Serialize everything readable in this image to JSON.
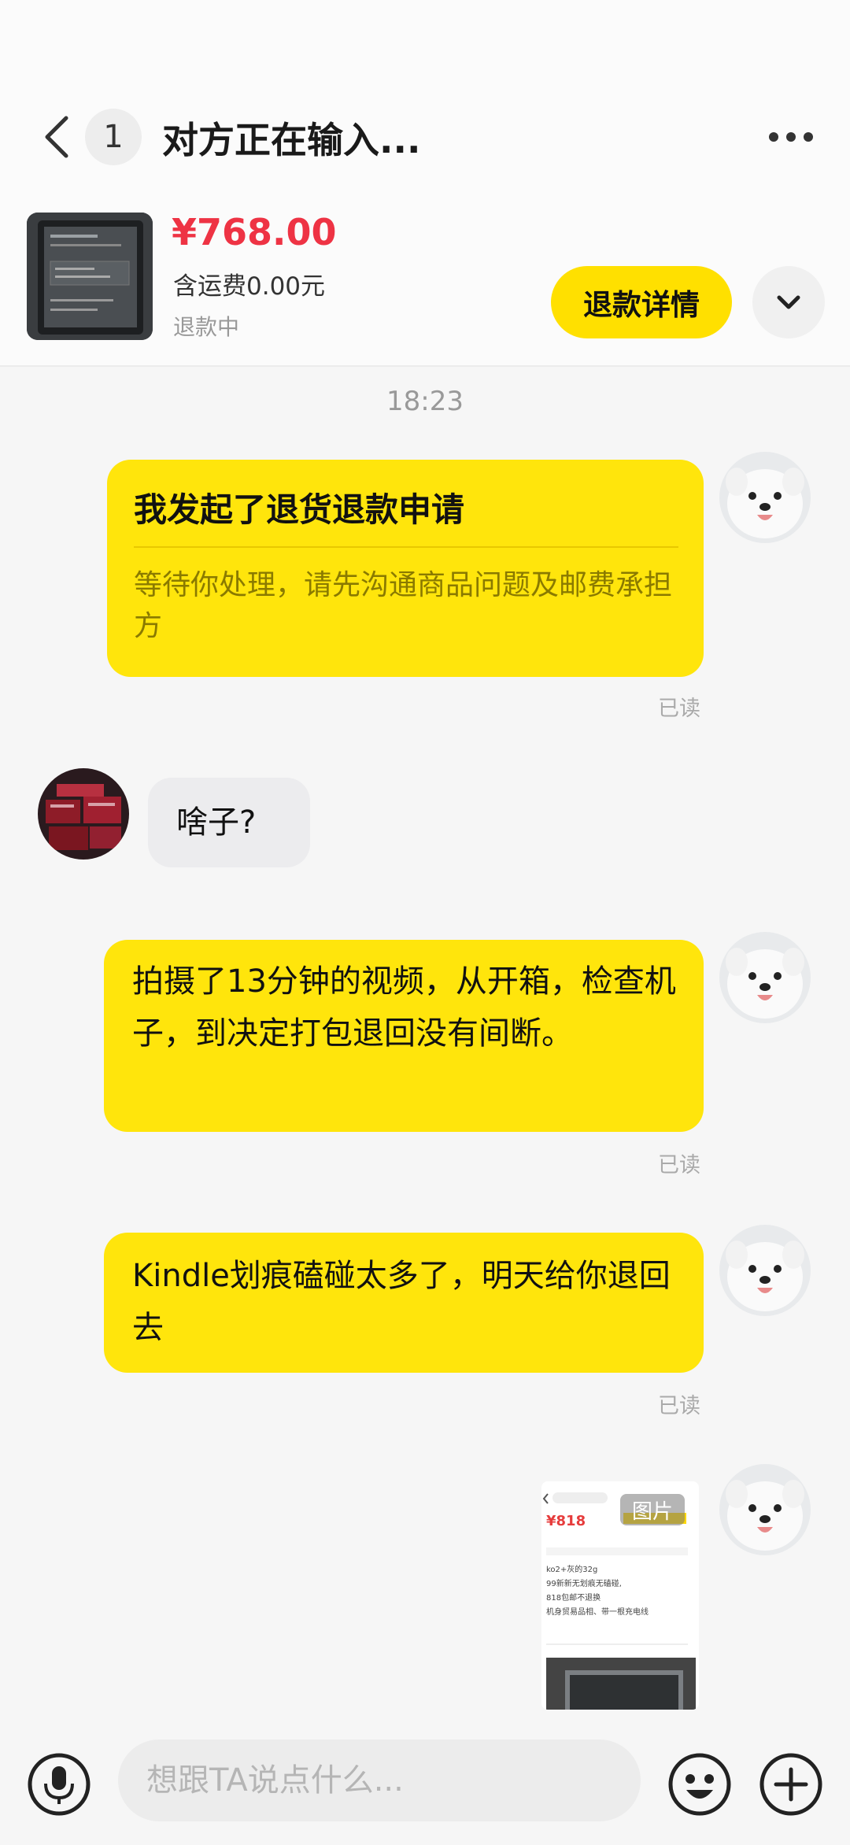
{
  "header": {
    "back_icon": "chevron-left-icon",
    "unread_count": "1",
    "title": "对方正在输入...",
    "more_icon": "more-horizontal-icon"
  },
  "product": {
    "price": "¥768.00",
    "shipping": "含运费0.00元",
    "status": "退款中",
    "refund_button": "退款详情",
    "expand_icon": "chevron-down-icon"
  },
  "chat": {
    "timestamp": "18:23",
    "refund_card": {
      "title": "我发起了退货退款申请",
      "subtitle": "等待你处理，请先沟通商品问题及邮费承担方",
      "read": "已读"
    },
    "other_message": {
      "text": "啥子?"
    },
    "message_2": {
      "text": "拍摄了13分钟的视频，从开箱，检查机子，到决定打包退回没有间断。",
      "read": "已读"
    },
    "message_3": {
      "text": "Kindle划痕磕碰太多了，明天给你退回去",
      "read": "已读"
    },
    "image_message": {
      "tag": "图片",
      "preview_price": "¥818",
      "preview_lines": [
        "ko2+灰的32g",
        "99新新无划痕无磕碰,",
        "818包邮不退换",
        "机身贸易品相、带一根充电线"
      ]
    }
  },
  "input_bar": {
    "mic_icon": "microphone-icon",
    "placeholder": "想跟TA说点什么...",
    "emoji_icon": "emoji-icon",
    "plus_icon": "plus-icon"
  },
  "colors": {
    "accent_yellow": "#ffe50c",
    "price_red": "#ee3344"
  }
}
